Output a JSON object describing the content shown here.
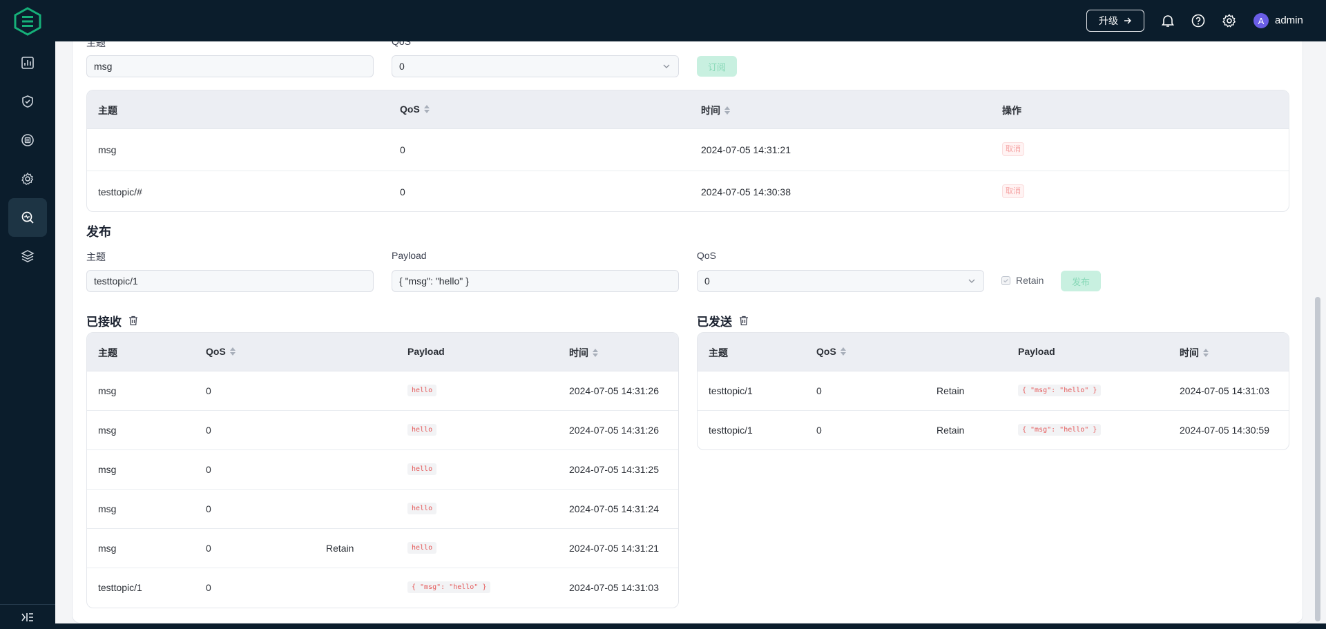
{
  "header": {
    "upgrade_label": "升级",
    "user_initial": "A",
    "user_name": "admin"
  },
  "subscribe": {
    "topic_label": "主题",
    "topic_value": "msg",
    "qos_label": "QoS",
    "qos_value": "0",
    "button_label": "订阅",
    "columns": [
      "主题",
      "QoS",
      "时间",
      "操作"
    ],
    "rows": [
      {
        "topic": "msg",
        "qos": "0",
        "time": "2024-07-05 14:31:21",
        "action": "取消"
      },
      {
        "topic": "testtopic/#",
        "qos": "0",
        "time": "2024-07-05 14:30:38",
        "action": "取消"
      }
    ]
  },
  "publish": {
    "title": "发布",
    "topic_label": "主题",
    "topic_value": "testtopic/1",
    "payload_label": "Payload",
    "payload_value": "{ \"msg\": \"hello\" }",
    "qos_label": "QoS",
    "qos_value": "0",
    "retain_label": "Retain",
    "button_label": "发布"
  },
  "received": {
    "title": "已接收",
    "columns": [
      "主题",
      "QoS",
      "Payload",
      "时间"
    ],
    "rows": [
      {
        "topic": "msg",
        "qos": "0",
        "retain": "",
        "payload": "hello",
        "time": "2024-07-05 14:31:26"
      },
      {
        "topic": "msg",
        "qos": "0",
        "retain": "",
        "payload": "hello",
        "time": "2024-07-05 14:31:26"
      },
      {
        "topic": "msg",
        "qos": "0",
        "retain": "",
        "payload": "hello",
        "time": "2024-07-05 14:31:25"
      },
      {
        "topic": "msg",
        "qos": "0",
        "retain": "",
        "payload": "hello",
        "time": "2024-07-05 14:31:24"
      },
      {
        "topic": "msg",
        "qos": "0",
        "retain": "Retain",
        "payload": "hello",
        "time": "2024-07-05 14:31:21"
      },
      {
        "topic": "testtopic/1",
        "qos": "0",
        "retain": "",
        "payload": "{ \"msg\": \"hello\" }",
        "time": "2024-07-05 14:31:03"
      }
    ]
  },
  "sent": {
    "title": "已发送",
    "columns": [
      "主题",
      "QoS",
      "Payload",
      "时间"
    ],
    "rows": [
      {
        "topic": "testtopic/1",
        "qos": "0",
        "retain": "Retain",
        "payload": "{ \"msg\": \"hello\" }",
        "time": "2024-07-05 14:31:03"
      },
      {
        "topic": "testtopic/1",
        "qos": "0",
        "retain": "Retain",
        "payload": "{ \"msg\": \"hello\" }",
        "time": "2024-07-05 14:30:59"
      }
    ]
  },
  "sidebar": {
    "items": [
      "dashboard-icon",
      "shield-check-icon",
      "integration-icon",
      "gear-cog-icon",
      "diagnose-icon",
      "layers-icon"
    ],
    "active_index": 4
  },
  "colors": {
    "accent": "#00b173",
    "nav_bg": "#0b1d2c",
    "danger": "#e55858"
  }
}
